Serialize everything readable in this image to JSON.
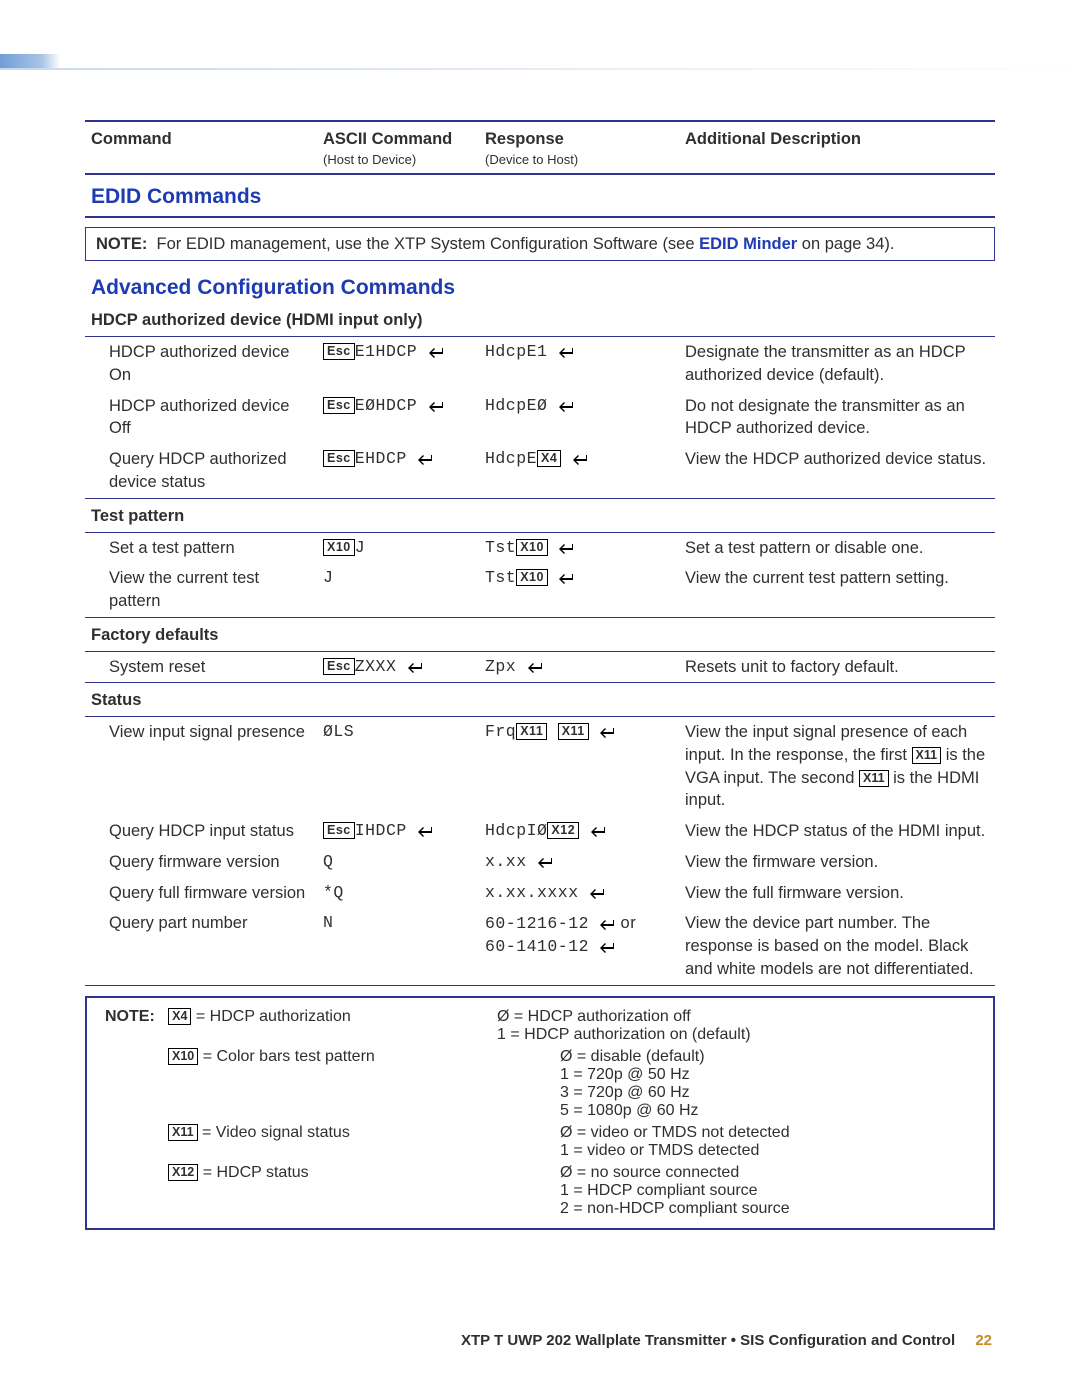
{
  "header": {
    "c1": "Command",
    "c2": "ASCII Command",
    "c2sub": "(Host to Device)",
    "c3": "Response",
    "c3sub": "(Device to Host)",
    "c4": "Additional Description"
  },
  "sections": {
    "edid": "EDID Commands",
    "advanced": "Advanced Configuration Commands",
    "hdcp": "HDCP authorized device (HDMI input only)",
    "test": "Test pattern",
    "factory": "Factory defaults",
    "status": "Status"
  },
  "note": {
    "label": "NOTE:",
    "text_a": "For EDID management, use the XTP System Configuration Software (see ",
    "link": "EDID Minder",
    "text_b": " on page 34)."
  },
  "keys": {
    "esc": "Esc",
    "x4": "X4",
    "x10": "X10",
    "x11": "X11",
    "x12": "X12"
  },
  "rows": {
    "r1": {
      "name": "HDCP authorized device On",
      "ascii_a": "E1HDCP",
      "resp": "HdcpE1",
      "desc": "Designate the transmitter as an HDCP authorized device (default)."
    },
    "r2": {
      "name": "HDCP authorized device Off",
      "ascii_a": "EØHDCP",
      "resp": "HdcpEØ",
      "desc": "Do not designate the transmitter as an HDCP authorized device."
    },
    "r3": {
      "name": "Query HDCP authorized device status",
      "ascii_a": "EHDCP",
      "resp": "HdcpE",
      "desc": "View the HDCP authorized device status."
    },
    "r4": {
      "name": "Set a test pattern",
      "ascii": "J",
      "resp": "Tst",
      "desc": "Set a test pattern or disable one."
    },
    "r5": {
      "name": "View the current test pattern",
      "ascii_plain": "J",
      "resp": "Tst",
      "desc": "View the current test pattern setting."
    },
    "r6": {
      "name": "System reset",
      "ascii_a": "ZXXX",
      "resp": "Zpx",
      "desc": "Resets unit to factory default."
    },
    "r7": {
      "name": "View input signal presence",
      "ascii_plain": "ØLS",
      "resp": "Frq",
      "desc_a": "View the input signal presence of each input. In the response, the first ",
      "desc_b": " is the VGA input. The second ",
      "desc_c": " is the HDMI input."
    },
    "r8": {
      "name": "Query HDCP input status",
      "ascii_a": "IHDCP",
      "resp": "HdcpIØ",
      "desc": "View the HDCP status of the HDMI input."
    },
    "r9": {
      "name": "Query firmware version",
      "ascii_plain": "Q",
      "resp": "x.xx",
      "desc": "View the firmware version."
    },
    "r10": {
      "name": "Query full firmware version",
      "ascii_plain": "*Q",
      "resp": "x.xx.xxxx",
      "desc": "View the full firmware version."
    },
    "r11": {
      "name": "Query part number",
      "ascii_plain": "N",
      "resp_a": "60-1216-12",
      "resp_or": " or",
      "resp_b": "60-1410-12",
      "desc": "View the device part number. The response is based on the model. Black and white models are not differentiated."
    }
  },
  "legend": {
    "label": "NOTE:",
    "x4": "= HDCP authorization",
    "x4v0": "Ø = HDCP authorization off",
    "x4v1": "1 = HDCP authorization on (default)",
    "x10": "= Color bars test pattern",
    "x10v0": "Ø = disable (default)",
    "x10v1": "1 = 720p @ 50 Hz",
    "x10v3": "3 = 720p @ 60 Hz",
    "x10v5": "5 = 1080p @ 60 Hz",
    "x11": "= Video signal status",
    "x11v0": "Ø = video or TMDS not detected",
    "x11v1": "1 = video or TMDS detected",
    "x12": "= HDCP status",
    "x12v0": "Ø = no source connected",
    "x12v1": "1 = HDCP compliant source",
    "x12v2": "2 = non-HDCP compliant source"
  },
  "footer": {
    "text": "XTP T UWP 202 Wallplate Transmitter • SIS Configuration and Control",
    "page": "22"
  }
}
